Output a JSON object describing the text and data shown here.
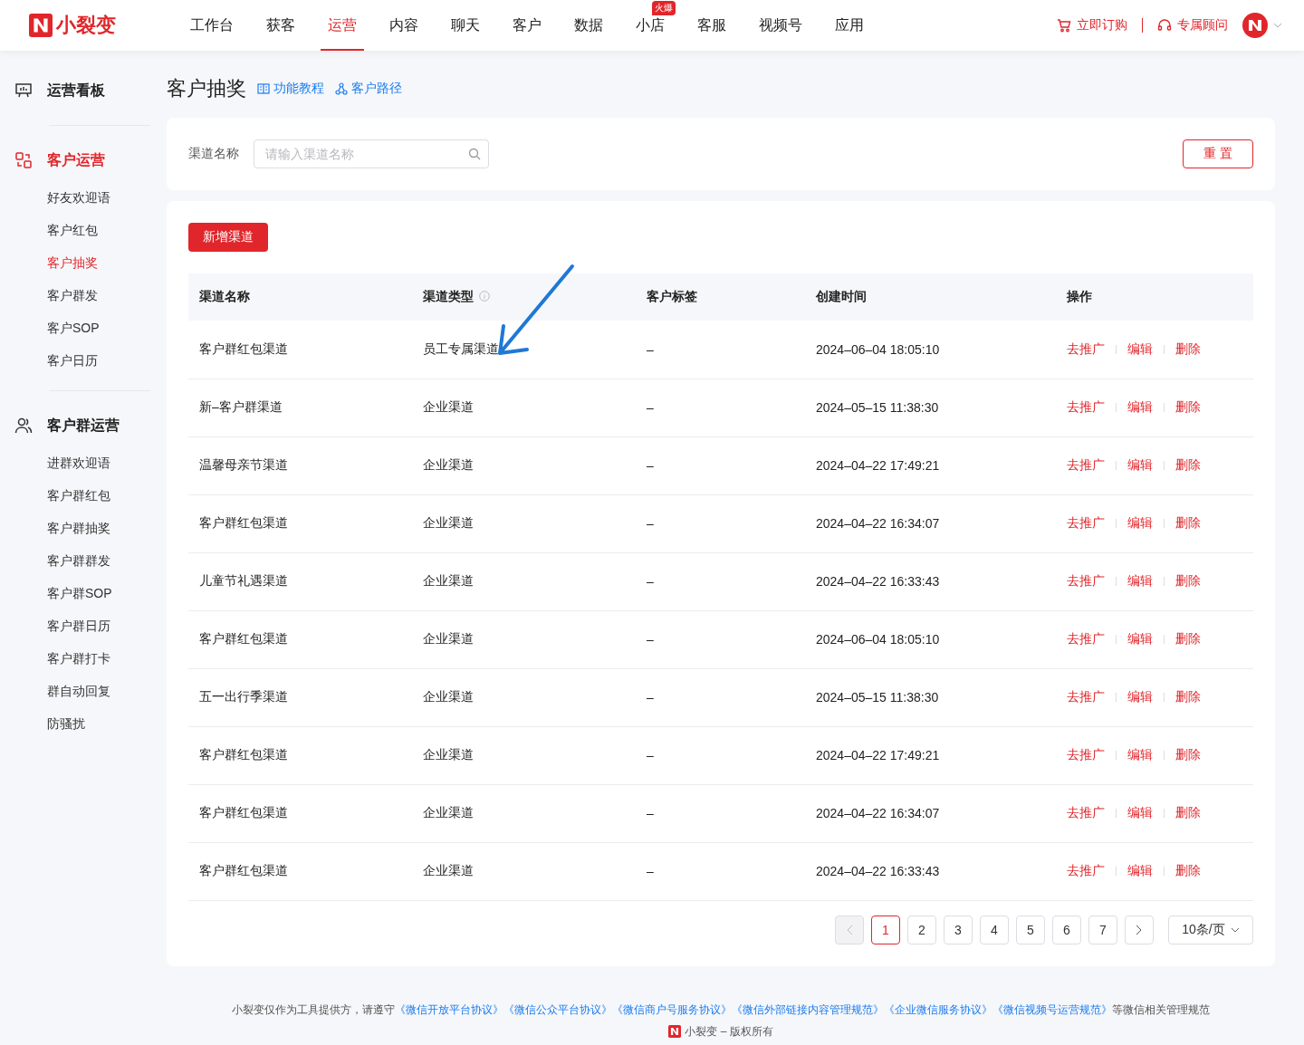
{
  "header": {
    "logo": "小裂变",
    "nav": [
      {
        "label": "工作台",
        "selected": false
      },
      {
        "label": "获客",
        "selected": false
      },
      {
        "label": "运营",
        "selected": true
      },
      {
        "label": "内容",
        "selected": false
      },
      {
        "label": "聊天",
        "selected": false
      },
      {
        "label": "客户",
        "selected": false
      },
      {
        "label": "数据",
        "selected": false
      },
      {
        "label": "小店",
        "selected": false,
        "badge": "火爆"
      },
      {
        "label": "客服",
        "selected": false
      },
      {
        "label": "视频号",
        "selected": false
      },
      {
        "label": "应用",
        "selected": false
      }
    ],
    "order": "立即订购",
    "advisor": "专属顾问"
  },
  "sidebar": {
    "groups": [
      {
        "title": "运营看板",
        "selected": false
      },
      {
        "title": "客户运营",
        "selected": true,
        "items": [
          {
            "label": "好友欢迎语",
            "selected": false
          },
          {
            "label": "客户红包",
            "selected": false
          },
          {
            "label": "客户抽奖",
            "selected": true
          },
          {
            "label": "客户群发",
            "selected": false
          },
          {
            "label": "客户SOP",
            "selected": false
          },
          {
            "label": "客户日历",
            "selected": false
          }
        ]
      },
      {
        "title": "客户群运营",
        "selected": false,
        "items": [
          {
            "label": "进群欢迎语",
            "selected": false
          },
          {
            "label": "客户群红包",
            "selected": false
          },
          {
            "label": "客户群抽奖",
            "selected": false
          },
          {
            "label": "客户群群发",
            "selected": false
          },
          {
            "label": "客户群SOP",
            "selected": false
          },
          {
            "label": "客户群日历",
            "selected": false
          },
          {
            "label": "客户群打卡",
            "selected": false
          },
          {
            "label": "群自动回复",
            "selected": false
          },
          {
            "label": "防骚扰",
            "selected": false
          }
        ]
      }
    ]
  },
  "page": {
    "title": "客户抽奖",
    "links": [
      "功能教程",
      "客户路径"
    ]
  },
  "filter": {
    "label": "渠道名称",
    "placeholder": "请输入渠道名称",
    "reset": "重 置"
  },
  "add_button": "新增渠道",
  "table": {
    "columns": [
      "渠道名称",
      "渠道类型",
      "客户标签",
      "创建时间",
      "操作"
    ],
    "rows": [
      {
        "name": "客户群红包渠道",
        "type": "员工专属渠道",
        "tags": "–",
        "created": "2024–06–04 18:05:10",
        "actions": [
          "去推广",
          "编辑",
          "删除"
        ]
      },
      {
        "name": "新–客户群渠道",
        "type": "企业渠道",
        "tags": "–",
        "created": "2024–05–15 11:38:30",
        "actions": [
          "去推广",
          "编辑",
          "删除"
        ]
      },
      {
        "name": "温馨母亲节渠道",
        "type": "企业渠道",
        "tags": "–",
        "created": "2024–04–22 17:49:21",
        "actions": [
          "去推广",
          "编辑",
          "删除"
        ]
      },
      {
        "name": "客户群红包渠道",
        "type": "企业渠道",
        "tags": "–",
        "created": "2024–04–22 16:34:07",
        "actions": [
          "去推广",
          "编辑",
          "删除"
        ]
      },
      {
        "name": "儿童节礼遇渠道",
        "type": "企业渠道",
        "tags": "–",
        "created": "2024–04–22 16:33:43",
        "actions": [
          "去推广",
          "编辑",
          "删除"
        ]
      },
      {
        "name": "客户群红包渠道",
        "type": "企业渠道",
        "tags": "–",
        "created": "2024–06–04 18:05:10",
        "actions": [
          "去推广",
          "编辑",
          "删除"
        ]
      },
      {
        "name": "五一出行季渠道",
        "type": "企业渠道",
        "tags": "–",
        "created": "2024–05–15 11:38:30",
        "actions": [
          "去推广",
          "编辑",
          "删除"
        ]
      },
      {
        "name": "客户群红包渠道",
        "type": "企业渠道",
        "tags": "–",
        "created": "2024–04–22 17:49:21",
        "actions": [
          "去推广",
          "编辑",
          "删除"
        ]
      },
      {
        "name": "客户群红包渠道",
        "type": "企业渠道",
        "tags": "–",
        "created": "2024–04–22 16:34:07",
        "actions": [
          "去推广",
          "编辑",
          "删除"
        ]
      },
      {
        "name": "客户群红包渠道",
        "type": "企业渠道",
        "tags": "–",
        "created": "2024–04–22 16:33:43",
        "actions": [
          "去推广",
          "编辑",
          "删除"
        ]
      }
    ]
  },
  "pagination": {
    "pages": [
      {
        "label": "1",
        "selected": true
      },
      {
        "label": "2",
        "selected": false
      },
      {
        "label": "3",
        "selected": false
      },
      {
        "label": "4",
        "selected": false
      },
      {
        "label": "5",
        "selected": false
      },
      {
        "label": "6",
        "selected": false
      },
      {
        "label": "7",
        "selected": false
      }
    ],
    "prev_disabled": true,
    "page_size": "10条/页"
  },
  "footer": {
    "prefix": "小裂变仅作为工具提供方，请遵守",
    "links": [
      "《微信开放平台协议》",
      "《微信公众平台协议》",
      "《微信商户号服务协议》",
      "《微信外部链接内容管理规范》",
      "《企业微信服务协议》",
      "《微信视频号运营规范》"
    ],
    "suffix": "等微信相关管理规范",
    "copyright": "小裂变 – 版权所有"
  }
}
